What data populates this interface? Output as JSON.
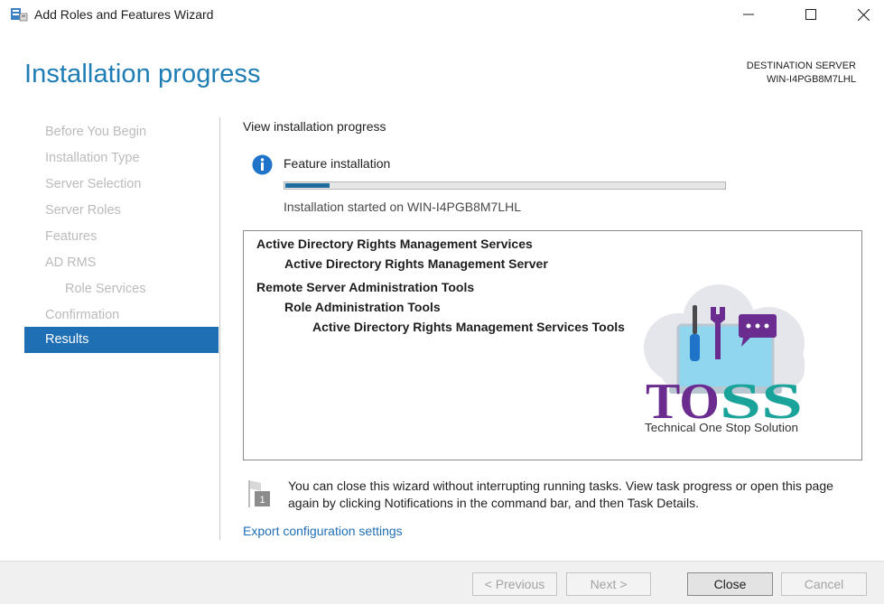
{
  "window": {
    "title": "Add Roles and Features Wizard",
    "minimize_icon": "minimize-icon",
    "maximize_icon": "maximize-icon",
    "close_icon": "close-icon"
  },
  "header": {
    "title": "Installation progress",
    "destination_label": "DESTINATION SERVER",
    "destination_server": "WIN-I4PGB8M7LHL"
  },
  "nav": {
    "items": [
      {
        "label": "Before You Begin"
      },
      {
        "label": "Installation Type"
      },
      {
        "label": "Server Selection"
      },
      {
        "label": "Server Roles"
      },
      {
        "label": "Features"
      },
      {
        "label": "AD RMS"
      },
      {
        "label": "Role Services"
      },
      {
        "label": "Confirmation"
      },
      {
        "label": "Results"
      }
    ],
    "active": "Results"
  },
  "content": {
    "section_title": "View installation progress",
    "feature_label": "Feature installation",
    "progress": 0.1,
    "status_text": "Installation started on WIN-I4PGB8M7LHL",
    "results": [
      {
        "text": "Active Directory Rights Management Services",
        "level": 0
      },
      {
        "text": "Active Directory Rights Management Server",
        "level": 1
      },
      {
        "text": "Remote Server Administration Tools",
        "level": 0
      },
      {
        "text": "Role Administration Tools",
        "level": 1
      },
      {
        "text": "Active Directory Rights Management Services Tools",
        "level": 2
      }
    ],
    "watermark": {
      "brand": "TOSS",
      "tagline": "Technical One Stop Solution"
    },
    "note_text": "You can close this wizard without interrupting running tasks. View task progress or open this page again by clicking Notifications in the command bar, and then Task Details.",
    "note_badge": "1",
    "export_link": "Export configuration settings"
  },
  "footer": {
    "previous": "< Previous",
    "next": "Next >",
    "close": "Close",
    "cancel": "Cancel"
  },
  "colors": {
    "accent": "#1e7db4",
    "nav_active": "#1f6fb5",
    "progress_fill": "#1f6c9f",
    "link": "#1f6fb5"
  }
}
